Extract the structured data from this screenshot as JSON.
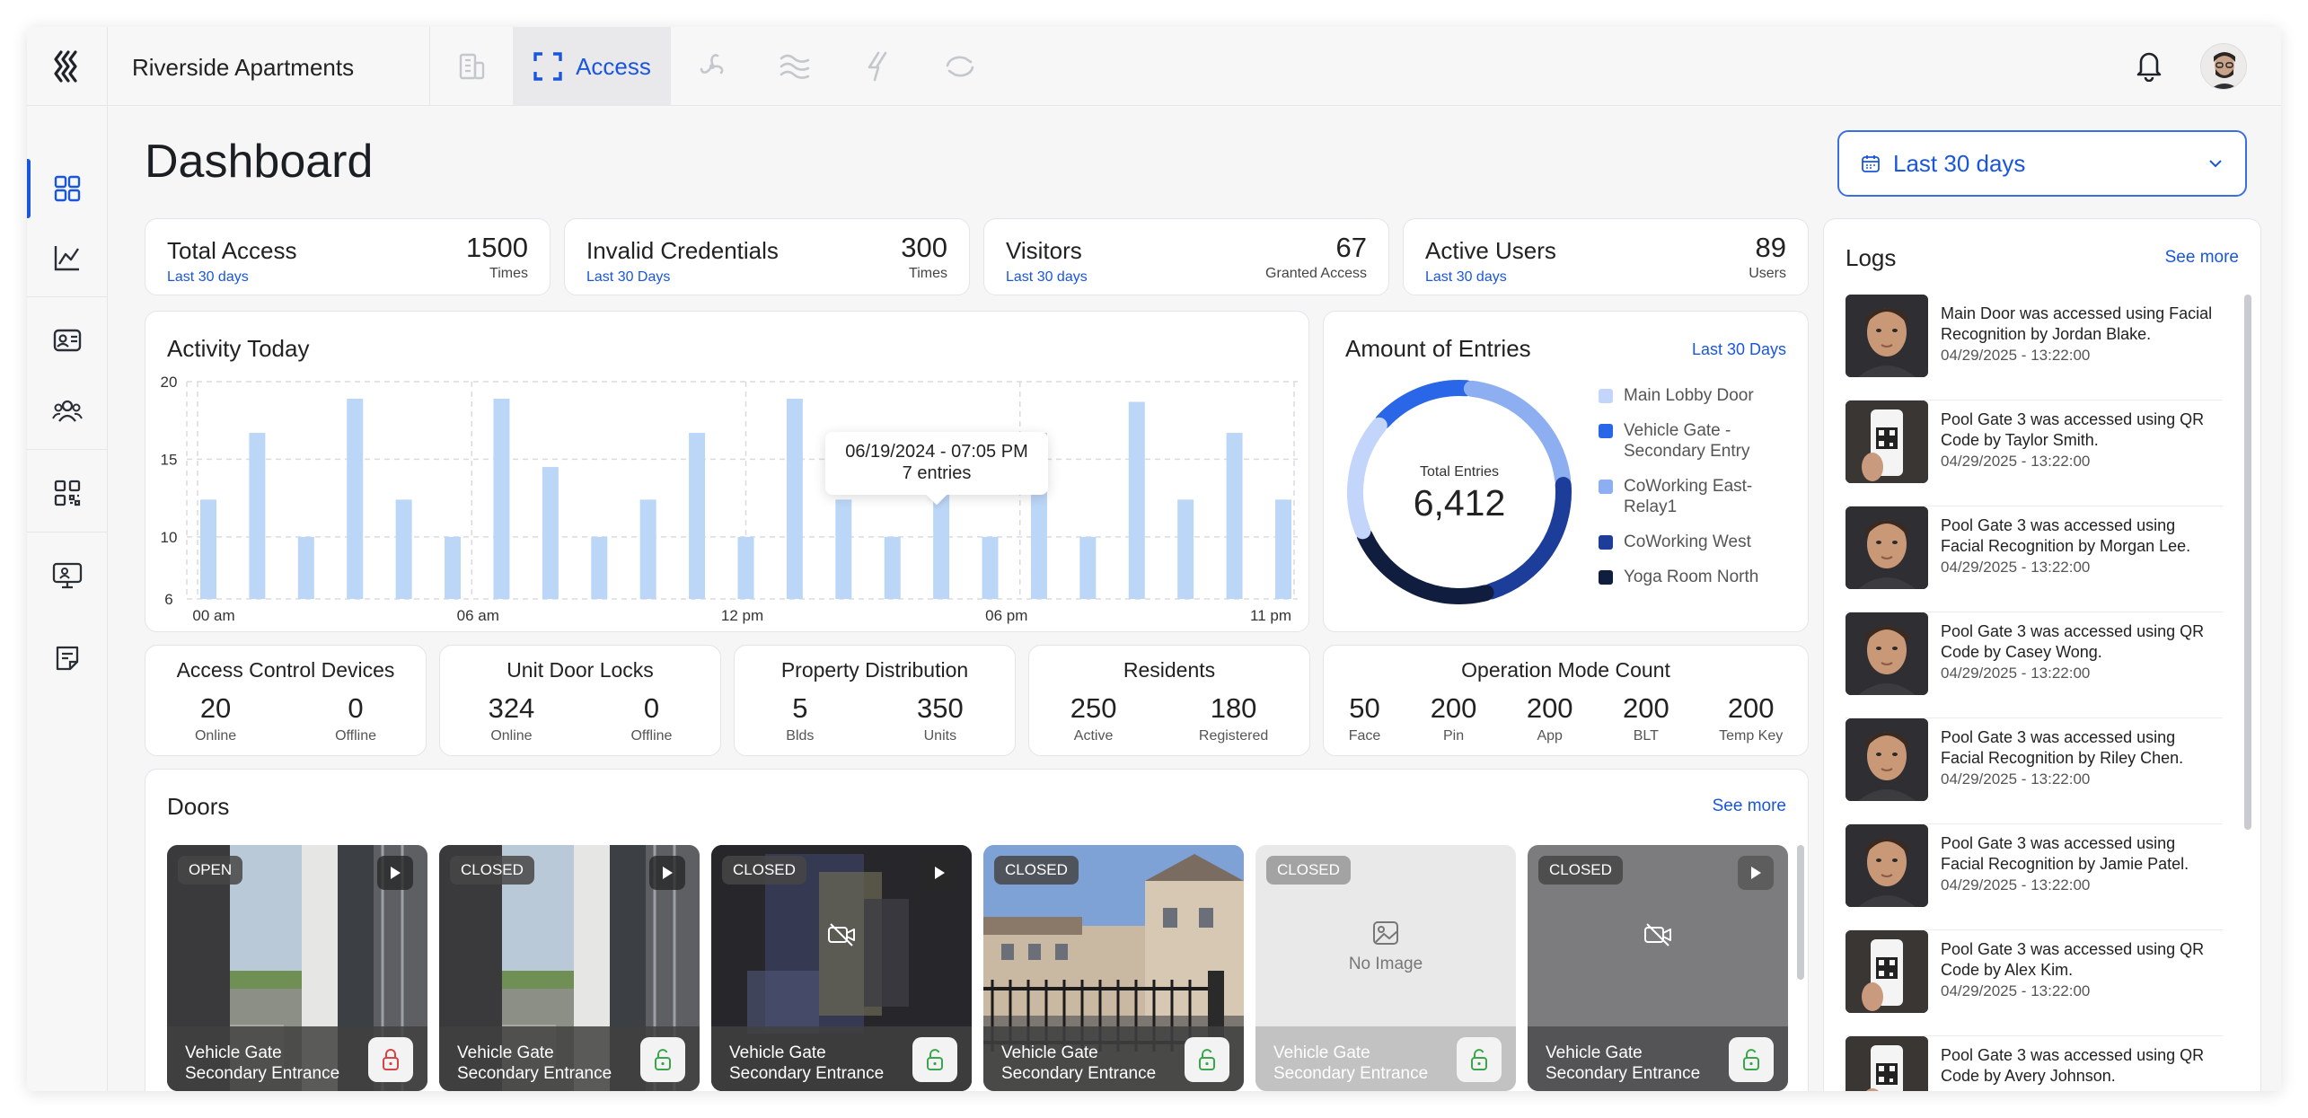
{
  "app": {
    "title": "Riverside Apartments",
    "active_tab_label": "Access",
    "accent": "#1a56db",
    "nav_tabs": [
      {
        "icon": "building-icon"
      },
      {
        "icon": "access-scan-icon",
        "label": "Access",
        "active": true
      },
      {
        "icon": "fan-icon"
      },
      {
        "icon": "waves-icon"
      },
      {
        "icon": "lightning-icon"
      },
      {
        "icon": "sync-icon"
      }
    ]
  },
  "sidebar": {
    "items": [
      {
        "icon": "dashboard-grid-icon",
        "active": true
      },
      {
        "icon": "line-chart-icon"
      },
      {
        "icon": "id-card-icon"
      },
      {
        "icon": "users-group-icon"
      },
      {
        "icon": "qr-code-icon"
      },
      {
        "icon": "monitor-icon"
      },
      {
        "icon": "note-icon"
      }
    ]
  },
  "page": {
    "title": "Dashboard",
    "range": "Last 30 days"
  },
  "stats": [
    {
      "label": "Total Access",
      "sub": "Last 30 days",
      "value": "1500",
      "unit": "Times"
    },
    {
      "label": "Invalid Credentials",
      "sub": "Last 30 Days",
      "value": "300",
      "unit": "Times"
    },
    {
      "label": "Visitors",
      "sub": "Last 30 days",
      "value": "67",
      "unit": "Granted Access"
    },
    {
      "label": "Active Users",
      "sub": "Last 30 days",
      "value": "89",
      "unit": "Users"
    }
  ],
  "activity": {
    "title": "Activity Today",
    "tooltip_date": "06/19/2024 - 07:05 PM",
    "tooltip_value": "7 entries"
  },
  "entries": {
    "title": "Amount of Entries",
    "link": "Last 30 Days",
    "center_label": "Total Entries",
    "center_value": "6,412",
    "legend": [
      {
        "name": "Main Lobby Door",
        "color": "#c3d5fb"
      },
      {
        "name": "Vehicle Gate - Secondary Entry",
        "color": "#2a66e8"
      },
      {
        "name": "CoWorking East-Relay1",
        "color": "#8eaef2"
      },
      {
        "name": "CoWorking West",
        "color": "#1d3d9b"
      },
      {
        "name": "Yoga Room North",
        "color": "#101d3f"
      }
    ]
  },
  "summaries": [
    {
      "title": "Access Control Devices",
      "cols": [
        {
          "num": "20",
          "cap": "Online"
        },
        {
          "num": "0",
          "cap": "Offline"
        }
      ]
    },
    {
      "title": "Unit Door Locks",
      "cols": [
        {
          "num": "324",
          "cap": "Online"
        },
        {
          "num": "0",
          "cap": "Offline"
        }
      ]
    },
    {
      "title": "Property Distribution",
      "cols": [
        {
          "num": "5",
          "cap": "Blds"
        },
        {
          "num": "350",
          "cap": "Units"
        }
      ]
    },
    {
      "title": "Residents",
      "cols": [
        {
          "num": "250",
          "cap": "Active"
        },
        {
          "num": "180",
          "cap": "Registered"
        }
      ]
    },
    {
      "title": "Operation Mode Count",
      "cols": [
        {
          "num": "50",
          "cap": "Face"
        },
        {
          "num": "200",
          "cap": "Pin"
        },
        {
          "num": "200",
          "cap": "App"
        },
        {
          "num": "200",
          "cap": "BLT"
        },
        {
          "num": "200",
          "cap": "Temp Key"
        }
      ]
    }
  ],
  "doors": {
    "title": "Doors",
    "link": "See more",
    "items": [
      {
        "status": "OPEN",
        "name": "Vehicle Gate",
        "sub": "Secondary Entrance",
        "lock": "locked",
        "media": "photo"
      },
      {
        "status": "CLOSED",
        "name": "Vehicle Gate",
        "sub": "Secondary Entrance",
        "lock": "unlocked",
        "media": "photo"
      },
      {
        "status": "CLOSED",
        "name": "Vehicle Gate",
        "sub": "Secondary Entrance",
        "lock": "unlocked",
        "media": "video-off"
      },
      {
        "status": "CLOSED",
        "name": "Vehicle Gate",
        "sub": "Secondary Entrance",
        "lock": "unlocked",
        "media": "gate-photo"
      },
      {
        "status": "CLOSED",
        "name": "Vehicle Gate",
        "sub": "Secondary Entrance",
        "lock": "unlocked",
        "media": "no-image",
        "no_image_label": "No Image"
      },
      {
        "status": "CLOSED",
        "name": "Vehicle Gate",
        "sub": "Secondary Entrance",
        "lock": "unlocked",
        "media": "video-off-grey"
      }
    ]
  },
  "logs": {
    "title": "Logs",
    "link": "See more",
    "items": [
      {
        "text": "Main Door was accessed using Facial Recognition by Jordan Blake.",
        "time": "04/29/2025 - 13:22:00",
        "thumb": "face"
      },
      {
        "text": "Pool Gate 3 was accessed using QR Code by Taylor Smith.",
        "time": "04/29/2025 - 13:22:00",
        "thumb": "qr"
      },
      {
        "text": "Pool Gate 3 was accessed using Facial Recognition by Morgan Lee.",
        "time": "04/29/2025 - 13:22:00",
        "thumb": "face"
      },
      {
        "text": "Pool Gate 3 was accessed using QR Code by Casey Wong.",
        "time": "04/29/2025 - 13:22:00",
        "thumb": "face"
      },
      {
        "text": "Pool Gate 3 was accessed using Facial Recognition by Riley Chen.",
        "time": "04/29/2025 - 13:22:00",
        "thumb": "face"
      },
      {
        "text": "Pool Gate 3 was accessed using Facial Recognition by Jamie Patel.",
        "time": "04/29/2025 - 13:22:00",
        "thumb": "face"
      },
      {
        "text": "Pool Gate 3 was accessed using QR Code by Alex Kim.",
        "time": "04/29/2025 - 13:22:00",
        "thumb": "qr"
      },
      {
        "text": "Pool Gate 3 was accessed using QR Code by Avery Johnson.",
        "time": "",
        "thumb": "qr"
      }
    ]
  },
  "chart_data": [
    {
      "type": "bar",
      "title": "Activity Today",
      "xlabel": "",
      "ylabel": "",
      "ylim": [
        6,
        20
      ],
      "y_ticks": [
        "20",
        "15",
        "10",
        "6"
      ],
      "x_ticks": [
        "00 am",
        "06 am",
        "12 pm",
        "06 pm",
        "11 pm"
      ],
      "grid": true,
      "highlighted_index": 13,
      "highlighted_label": "06/19/2024 - 07:05 PM",
      "values": [
        12.4,
        16.7,
        10,
        18.9,
        12.4,
        10,
        18.9,
        14.5,
        10,
        12.4,
        16.7,
        10,
        18.9,
        12.4,
        10,
        14.5,
        10,
        16.7,
        10,
        18.7,
        12.4,
        16.7,
        12.4
      ]
    },
    {
      "type": "pie",
      "title": "Amount of Entries",
      "categories": [
        "Main Lobby Door",
        "Vehicle Gate - Secondary Entry",
        "CoWorking East-Relay1",
        "CoWorking West",
        "Yoga Room North"
      ],
      "values": [
        18,
        15,
        22,
        22,
        23
      ],
      "hole": true,
      "legend": "right"
    }
  ]
}
